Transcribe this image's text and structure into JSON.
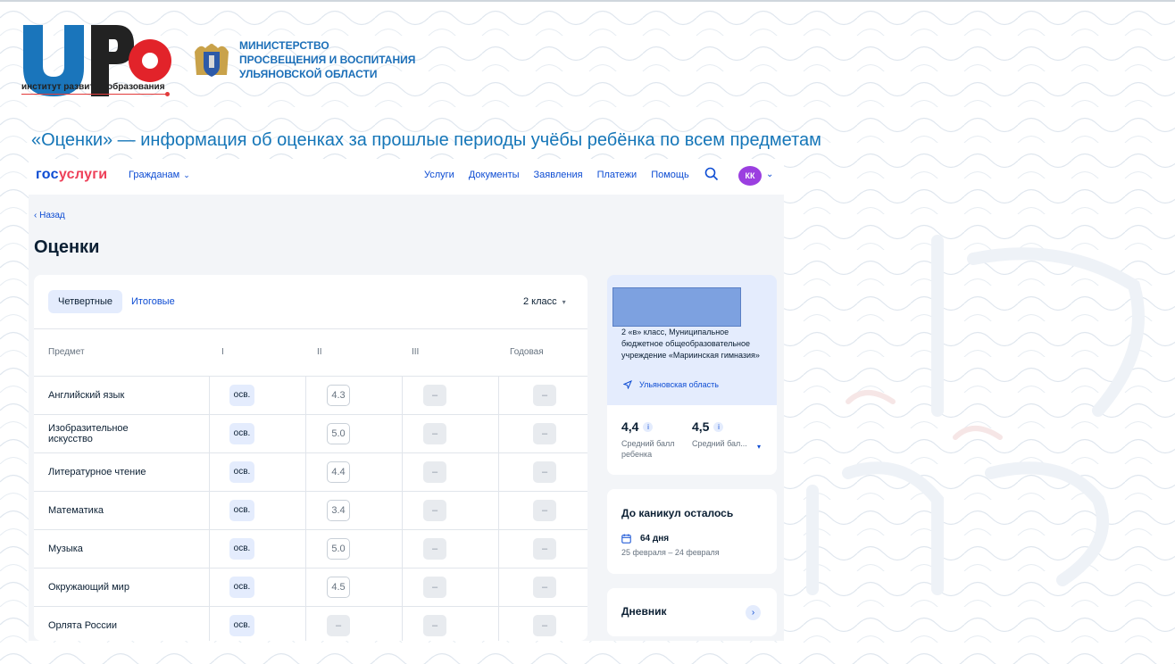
{
  "branding": {
    "irr_letters": "IPO",
    "irr_subtitle": "институт развития образования",
    "ministry_lines": [
      "МИНИСТЕРСТВО",
      "ПРОСВЕЩЕНИЯ И ВОСПИТАНИЯ",
      "УЛЬЯНОВСКОЙ ОБЛАСТИ"
    ]
  },
  "slide_title": "«Оценки» — информация об оценках за прошлые периоды учёбы ребёнка по всем предметам",
  "header": {
    "logo_part1": "гос",
    "logo_part2": "услуги",
    "citizens": "Гражданам",
    "nav": [
      "Услуги",
      "Документы",
      "Заявления",
      "Платежи",
      "Помощь"
    ],
    "avatar_initials": "КК"
  },
  "page": {
    "back": "Назад",
    "title": "Оценки"
  },
  "grades": {
    "tabs": [
      "Четвертные",
      "Итоговые"
    ],
    "active_tab": "Четвертные",
    "class_selected": "2 класс",
    "columns": [
      "Предмет",
      "I",
      "II",
      "III",
      "Годовая"
    ],
    "rows": [
      {
        "subject": "Английский язык",
        "cells": [
          "осв.",
          "4.3",
          "–",
          "–"
        ]
      },
      {
        "subject": "Изобразительное искусство",
        "cells": [
          "осв.",
          "5.0",
          "–",
          "–"
        ]
      },
      {
        "subject": "Литературное чтение",
        "cells": [
          "осв.",
          "4.4",
          "–",
          "–"
        ]
      },
      {
        "subject": "Математика",
        "cells": [
          "осв.",
          "3.4",
          "–",
          "–"
        ]
      },
      {
        "subject": "Музыка",
        "cells": [
          "осв.",
          "5.0",
          "–",
          "–"
        ]
      },
      {
        "subject": "Окружающий мир",
        "cells": [
          "осв.",
          "4.5",
          "–",
          "–"
        ]
      },
      {
        "subject": "Орлята России",
        "cells": [
          "осв.",
          "–",
          "–",
          "–"
        ]
      }
    ]
  },
  "school": {
    "description": "2 «в» класс, Муниципальное бюджетное общеобразовательное учреждение «Мариинская гимназия»",
    "region": "Ульяновская область"
  },
  "averages": [
    {
      "value": "4,4",
      "label": "Средний балл ребенка"
    },
    {
      "value": "4,5",
      "label": "Средний бал..."
    }
  ],
  "vacation": {
    "title": "До каникул осталось",
    "days": "64 дня",
    "range": "25 февраля – 24 февраля"
  },
  "diary": {
    "title": "Дневник"
  },
  "colors": {
    "brand_blue": "#0d4cd3",
    "brand_red": "#ee3f58",
    "slide_title": "#1576b8",
    "avatar": "#9b3fe0"
  }
}
